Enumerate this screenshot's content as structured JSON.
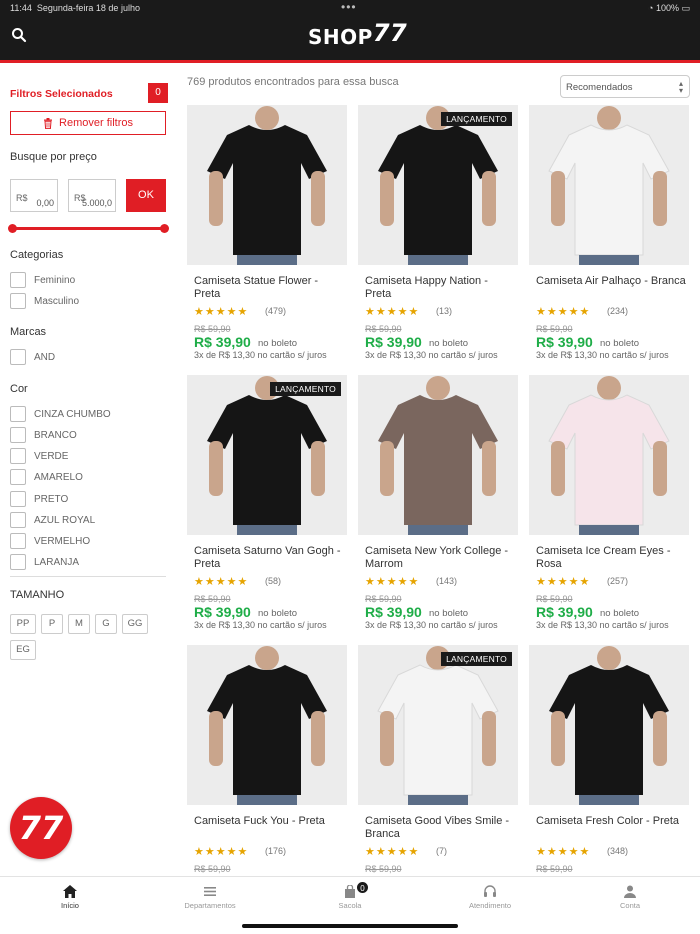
{
  "status": {
    "time": "11:44",
    "date": "Segunda-feira 18 de julho",
    "battery": "100%"
  },
  "header": {
    "logo_text": "SHOP",
    "logo_num": "77"
  },
  "filters": {
    "selected_label": "Filtros Selecionados",
    "selected_count": "0",
    "remove_label": "Remover filtros",
    "price_title": "Busque por preço",
    "currency": "R$",
    "min_value": "0,00",
    "max_value": "5.000,0",
    "ok_label": "OK",
    "price_range": [
      0,
      5000
    ],
    "categories_title": "Categorias",
    "categories": [
      "Feminino",
      "Masculino"
    ],
    "brands_title": "Marcas",
    "brands": [
      "AND"
    ],
    "colors_title": "Cor",
    "colors": [
      "CINZA CHUMBO",
      "BRANCO",
      "VERDE",
      "AMARELO",
      "PRETO",
      "AZUL ROYAL",
      "VERMELHO",
      "LARANJA"
    ],
    "sizes_title": "TAMANHO",
    "sizes": [
      "PP",
      "P",
      "M",
      "G",
      "GG",
      "EG"
    ]
  },
  "float_button": "77",
  "results": {
    "count_text": "769 produtos encontrados para essa busca",
    "sort_label": "Recomendados"
  },
  "products": [
    {
      "name": "Camiseta Statue Flower - Preta",
      "badge": "",
      "stars": "★★★★★",
      "reviews": "(479)",
      "old_price": "R$ 59,90",
      "price": "R$ 39,90",
      "price_note": "no boleto",
      "installments": "3x de R$ 13,30 no cartão s/ juros",
      "shirt": "#151515"
    },
    {
      "name": "Camiseta Happy Nation - Preta",
      "badge": "LANÇAMENTO",
      "stars": "★★★★★",
      "reviews": "(13)",
      "old_price": "R$ 59,90",
      "price": "R$ 39,90",
      "price_note": "no boleto",
      "installments": "3x de R$ 13,30 no cartão s/ juros",
      "shirt": "#151515"
    },
    {
      "name": "Camiseta Air Palhaço - Branca",
      "badge": "",
      "stars": "★★★★★",
      "reviews": "(234)",
      "old_price": "R$ 59,90",
      "price": "R$ 39,90",
      "price_note": "no boleto",
      "installments": "3x de R$ 13,30 no cartão s/ juros",
      "shirt": "#f4f4f4"
    },
    {
      "name": "Camiseta Saturno Van Gogh - Preta",
      "badge": "LANÇAMENTO",
      "stars": "★★★★★",
      "reviews": "(58)",
      "old_price": "R$ 59,90",
      "price": "R$ 39,90",
      "price_note": "no boleto",
      "installments": "3x de R$ 13,30 no cartão s/ juros",
      "shirt": "#151515"
    },
    {
      "name": "Camiseta New York College - Marrom",
      "badge": "",
      "stars": "★★★★★",
      "reviews": "(143)",
      "old_price": "R$ 59,90",
      "price": "R$ 39,90",
      "price_note": "no boleto",
      "installments": "3x de R$ 13,30 no cartão s/ juros",
      "shirt": "#7a665e"
    },
    {
      "name": "Camiseta Ice Cream Eyes - Rosa",
      "badge": "",
      "stars": "★★★★★",
      "reviews": "(257)",
      "old_price": "R$ 59,90",
      "price": "R$ 39,90",
      "price_note": "no boleto",
      "installments": "3x de R$ 13,30 no cartão s/ juros",
      "shirt": "#f6e4ea"
    },
    {
      "name": "Camiseta Fuck You - Preta",
      "badge": "",
      "stars": "★★★★★",
      "reviews": "(176)",
      "old_price": "R$ 59,90",
      "price": "",
      "price_note": "",
      "installments": "",
      "shirt": "#151515"
    },
    {
      "name": "Camiseta Good Vibes Smile - Branca",
      "badge": "LANÇAMENTO",
      "stars": "★★★★★",
      "reviews": "(7)",
      "old_price": "R$ 59,90",
      "price": "",
      "price_note": "",
      "installments": "",
      "shirt": "#f4f4f4"
    },
    {
      "name": "Camiseta Fresh Color - Preta",
      "badge": "",
      "stars": "★★★★★",
      "reviews": "(348)",
      "old_price": "R$ 59,90",
      "price": "",
      "price_note": "",
      "installments": "",
      "shirt": "#151515"
    }
  ],
  "tabs": [
    {
      "label": "Início",
      "icon": "home-icon",
      "active": true
    },
    {
      "label": "Departamentos",
      "icon": "list-icon",
      "active": false
    },
    {
      "label": "Sacola",
      "icon": "bag-icon",
      "active": false,
      "badge": "0"
    },
    {
      "label": "Atendimento",
      "icon": "headset-icon",
      "active": false
    },
    {
      "label": "Conta",
      "icon": "user-icon",
      "active": false
    }
  ],
  "colors": {
    "brand_red": "#e01e25",
    "price_green": "#1fad48",
    "star": "#e6a400",
    "header": "#1a1a1a"
  }
}
